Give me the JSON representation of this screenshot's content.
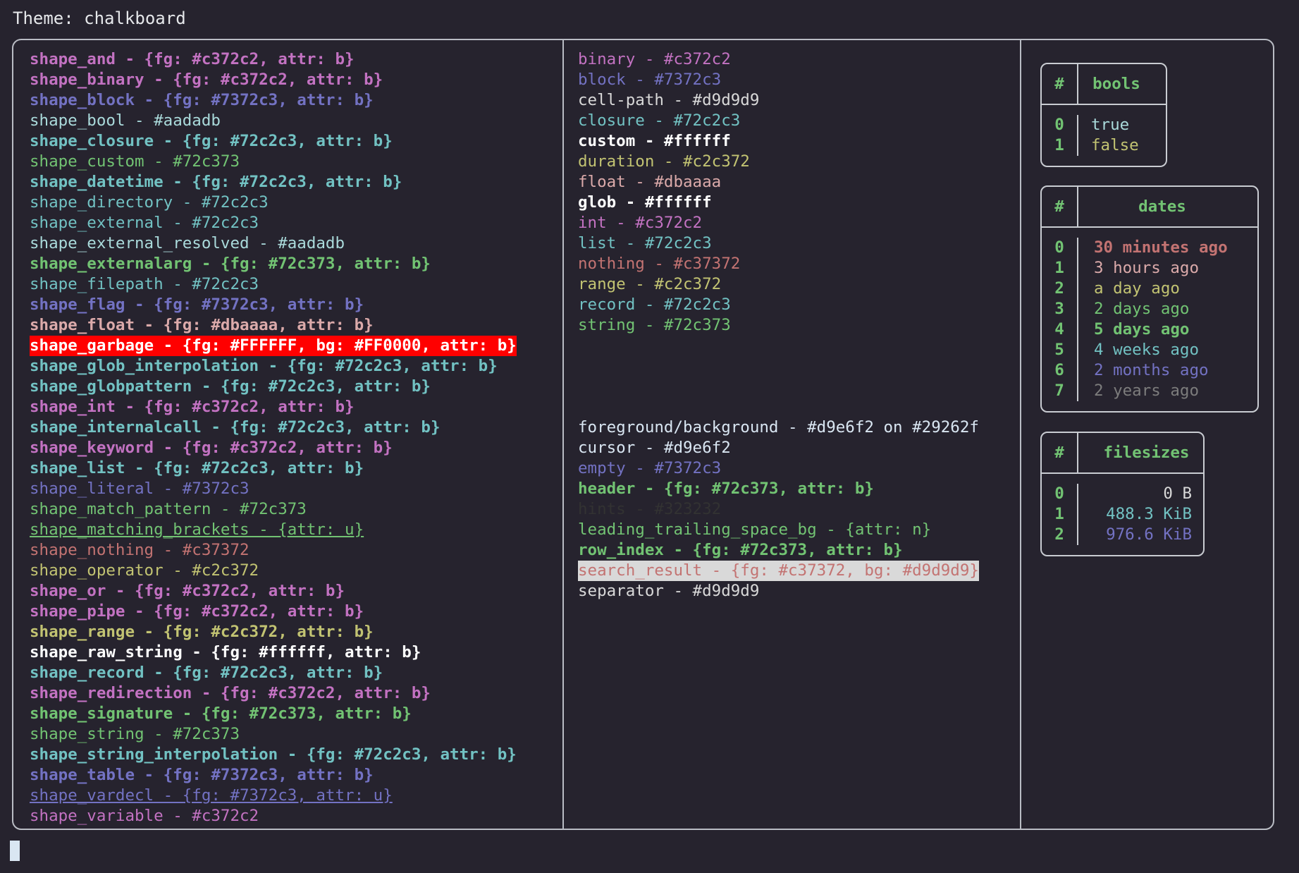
{
  "header": {
    "theme_label": "Theme: chalkboard"
  },
  "colors": {
    "background": "#26232e",
    "foreground": "#d9e6f2",
    "border": "#b9bcc4",
    "cursor": "#d9e6f2"
  },
  "panels": {
    "shapes": {
      "rows": [
        {
          "text": "shape_and - {fg: #c372c2, attr: b}",
          "color": "#c372c2",
          "bold": true,
          "underline": false
        },
        {
          "text": "shape_binary - {fg: #c372c2, attr: b}",
          "color": "#c372c2",
          "bold": true,
          "underline": false
        },
        {
          "text": "shape_block - {fg: #7372c3, attr: b}",
          "color": "#7372c3",
          "bold": true,
          "underline": false
        },
        {
          "text": "shape_bool - #aadadb",
          "color": "#aadadb",
          "bold": false,
          "underline": false
        },
        {
          "text": "shape_closure - {fg: #72c2c3, attr: b}",
          "color": "#72c2c3",
          "bold": true,
          "underline": false
        },
        {
          "text": "shape_custom - #72c373",
          "color": "#72c373",
          "bold": false,
          "underline": false
        },
        {
          "text": "shape_datetime - {fg: #72c2c3, attr: b}",
          "color": "#72c2c3",
          "bold": true,
          "underline": false
        },
        {
          "text": "shape_directory - #72c2c3",
          "color": "#72c2c3",
          "bold": false,
          "underline": false
        },
        {
          "text": "shape_external - #72c2c3",
          "color": "#72c2c3",
          "bold": false,
          "underline": false
        },
        {
          "text": "shape_external_resolved - #aadadb",
          "color": "#aadadb",
          "bold": false,
          "underline": false
        },
        {
          "text": "shape_externalarg - {fg: #72c373, attr: b}",
          "color": "#72c373",
          "bold": true,
          "underline": false
        },
        {
          "text": "shape_filepath - #72c2c3",
          "color": "#72c2c3",
          "bold": false,
          "underline": false
        },
        {
          "text": "shape_flag - {fg: #7372c3, attr: b}",
          "color": "#7372c3",
          "bold": true,
          "underline": false
        },
        {
          "text": "shape_float - {fg: #dbaaaa, attr: b}",
          "color": "#dbaaaa",
          "bold": true,
          "underline": false
        },
        {
          "text": "shape_garbage - {fg: #FFFFFF, bg: #FF0000, attr: b}",
          "color": "#ffffff",
          "bg": "#ff0000",
          "bold": true,
          "underline": false
        },
        {
          "text": "shape_glob_interpolation - {fg: #72c2c3, attr: b}",
          "color": "#72c2c3",
          "bold": true,
          "underline": false
        },
        {
          "text": "shape_globpattern - {fg: #72c2c3, attr: b}",
          "color": "#72c2c3",
          "bold": true,
          "underline": false
        },
        {
          "text": "shape_int - {fg: #c372c2, attr: b}",
          "color": "#c372c2",
          "bold": true,
          "underline": false
        },
        {
          "text": "shape_internalcall - {fg: #72c2c3, attr: b}",
          "color": "#72c2c3",
          "bold": true,
          "underline": false
        },
        {
          "text": "shape_keyword - {fg: #c372c2, attr: b}",
          "color": "#c372c2",
          "bold": true,
          "underline": false
        },
        {
          "text": "shape_list - {fg: #72c2c3, attr: b}",
          "color": "#72c2c3",
          "bold": true,
          "underline": false
        },
        {
          "text": "shape_literal - #7372c3",
          "color": "#7372c3",
          "bold": false,
          "underline": false
        },
        {
          "text": "shape_match_pattern - #72c373",
          "color": "#72c373",
          "bold": false,
          "underline": false
        },
        {
          "text": "shape_matching_brackets - {attr: u}",
          "color": "#72c373",
          "bold": false,
          "underline": true
        },
        {
          "text": "shape_nothing - #c37372",
          "color": "#c37372",
          "bold": false,
          "underline": false
        },
        {
          "text": "shape_operator - #c2c372",
          "color": "#c2c372",
          "bold": false,
          "underline": false
        },
        {
          "text": "shape_or - {fg: #c372c2, attr: b}",
          "color": "#c372c2",
          "bold": true,
          "underline": false
        },
        {
          "text": "shape_pipe - {fg: #c372c2, attr: b}",
          "color": "#c372c2",
          "bold": true,
          "underline": false
        },
        {
          "text": "shape_range - {fg: #c2c372, attr: b}",
          "color": "#c2c372",
          "bold": true,
          "underline": false
        },
        {
          "text": "shape_raw_string - {fg: #ffffff, attr: b}",
          "color": "#ffffff",
          "bold": true,
          "underline": false
        },
        {
          "text": "shape_record - {fg: #72c2c3, attr: b}",
          "color": "#72c2c3",
          "bold": true,
          "underline": false
        },
        {
          "text": "shape_redirection - {fg: #c372c2, attr: b}",
          "color": "#c372c2",
          "bold": true,
          "underline": false
        },
        {
          "text": "shape_signature - {fg: #72c373, attr: b}",
          "color": "#72c373",
          "bold": true,
          "underline": false
        },
        {
          "text": "shape_string - #72c373",
          "color": "#72c373",
          "bold": false,
          "underline": false
        },
        {
          "text": "shape_string_interpolation - {fg: #72c2c3, attr: b}",
          "color": "#72c2c3",
          "bold": true,
          "underline": false
        },
        {
          "text": "shape_table - {fg: #7372c3, attr: b}",
          "color": "#7372c3",
          "bold": true,
          "underline": false
        },
        {
          "text": "shape_vardecl - {fg: #7372c3, attr: u}",
          "color": "#7372c3",
          "bold": false,
          "underline": true
        },
        {
          "text": "shape_variable - #c372c2",
          "color": "#c372c2",
          "bold": false,
          "underline": false
        }
      ]
    },
    "types": {
      "rows": [
        {
          "text": "binary - #c372c2",
          "color": "#c372c2",
          "bold": false,
          "underline": false
        },
        {
          "text": "block - #7372c3",
          "color": "#7372c3",
          "bold": false,
          "underline": false
        },
        {
          "text": "cell-path - #d9d9d9",
          "color": "#d9d9d9",
          "bold": false,
          "underline": false
        },
        {
          "text": "closure - #72c2c3",
          "color": "#72c2c3",
          "bold": false,
          "underline": false
        },
        {
          "text": "custom - #ffffff",
          "color": "#ffffff",
          "bold": true,
          "underline": false
        },
        {
          "text": "duration - #c2c372",
          "color": "#c2c372",
          "bold": false,
          "underline": false
        },
        {
          "text": "float - #dbaaaa",
          "color": "#dbaaaa",
          "bold": false,
          "underline": false
        },
        {
          "text": "glob - #ffffff",
          "color": "#ffffff",
          "bold": true,
          "underline": false
        },
        {
          "text": "int - #c372c2",
          "color": "#c372c2",
          "bold": false,
          "underline": false
        },
        {
          "text": "list - #72c2c3",
          "color": "#72c2c3",
          "bold": false,
          "underline": false
        },
        {
          "text": "nothing - #c37372",
          "color": "#c37372",
          "bold": false,
          "underline": false
        },
        {
          "text": "range - #c2c372",
          "color": "#c2c372",
          "bold": false,
          "underline": false
        },
        {
          "text": "record - #72c2c3",
          "color": "#72c2c3",
          "bold": false,
          "underline": false
        },
        {
          "text": "string - #72c373",
          "color": "#72c373",
          "bold": false,
          "underline": false
        }
      ]
    },
    "ui": {
      "rows": [
        {
          "text": "foreground/background - #d9e6f2 on #29262f",
          "color": "#d9e6f2",
          "bold": false,
          "underline": false
        },
        {
          "text": "cursor - #d9e6f2",
          "color": "#d9e6f2",
          "bold": false,
          "underline": false
        },
        {
          "text": "empty - #7372c3",
          "color": "#7372c3",
          "bold": false,
          "underline": false
        },
        {
          "text": "header - {fg: #72c373, attr: b}",
          "color": "#72c373",
          "bold": true,
          "underline": false
        },
        {
          "text": "hints - #323232",
          "color": "#323232",
          "bold": false,
          "underline": false
        },
        {
          "text": "leading_trailing_space_bg - {attr: n}",
          "color": "#72c373",
          "bold": false,
          "underline": false
        },
        {
          "text": "row_index - {fg: #72c373, attr: b}",
          "color": "#72c373",
          "bold": true,
          "underline": false
        },
        {
          "text": "search_result - {fg: #c37372, bg: #d9d9d9}",
          "color": "#c37372",
          "bg": "#d9d9d9",
          "bold": false,
          "underline": false
        },
        {
          "text": "separator - #d9d9d9",
          "color": "#d9d9d9",
          "bold": false,
          "underline": false
        }
      ]
    }
  },
  "tables": [
    {
      "name": "bools",
      "index_header": "#",
      "value_header": "bools",
      "rows": [
        {
          "index": "0",
          "value": "true",
          "color": "#aadadb",
          "bold": false
        },
        {
          "index": "1",
          "value": "false",
          "color": "#c2c372",
          "bold": false
        }
      ]
    },
    {
      "name": "dates",
      "index_header": "#",
      "value_header": "dates",
      "rows": [
        {
          "index": "0",
          "value": "30 minutes ago",
          "color": "#c37372",
          "bold": true
        },
        {
          "index": "1",
          "value": "3 hours ago",
          "color": "#dbaaaa",
          "bold": false
        },
        {
          "index": "2",
          "value": "a day ago",
          "color": "#c2c372",
          "bold": false
        },
        {
          "index": "3",
          "value": "2 days ago",
          "color": "#72c373",
          "bold": false
        },
        {
          "index": "4",
          "value": "5 days ago",
          "color": "#72c373",
          "bold": true
        },
        {
          "index": "5",
          "value": "4 weeks ago",
          "color": "#72c2c3",
          "bold": false
        },
        {
          "index": "6",
          "value": "2 months ago",
          "color": "#7372c3",
          "bold": false
        },
        {
          "index": "7",
          "value": "2 years ago",
          "color": "#7c7c7c",
          "bold": false
        }
      ]
    },
    {
      "name": "filesizes",
      "index_header": "#",
      "value_header": "filesizes",
      "rows": [
        {
          "index": "0",
          "value": "0 B",
          "color": "#d9d9d9",
          "bold": false
        },
        {
          "index": "1",
          "value": "488.3 KiB",
          "color": "#72c2c3",
          "bold": false
        },
        {
          "index": "2",
          "value": "976.6 KiB",
          "color": "#7372c3",
          "bold": false
        }
      ]
    }
  ],
  "terminal": {
    "cursor_visible": true
  }
}
